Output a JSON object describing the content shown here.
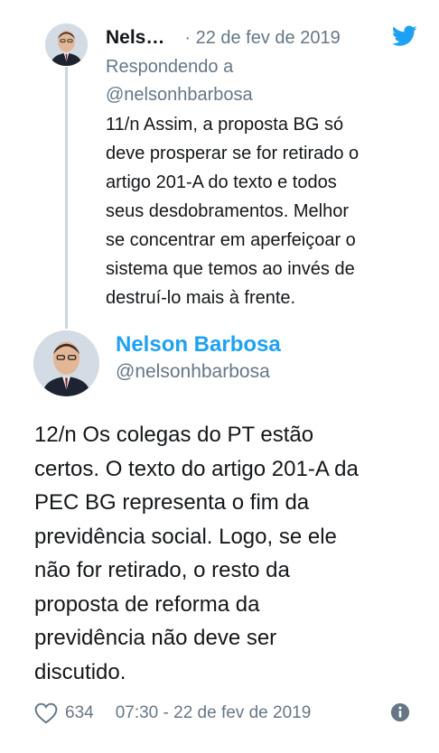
{
  "reply": {
    "author_name": "Nels…",
    "date": "· 22 de fev de 2019",
    "context_line1": "Respondendo a",
    "context_line2": "@nelsonhbarbosa",
    "text": "11/n Assim, a proposta BG só\ndeve prosperar se for retirado o\nartigo 201-A do texto e todos\nseus desdobramentos. Melhor\nse concentrar em aperfeiçoar o\nsistema que temos ao invés de\ndestruí-lo mais à frente."
  },
  "main": {
    "author_name": "Nelson Barbosa",
    "handle": "@nelsonhbarbosa",
    "text": "12/n Os colegas do PT estão\ncertos. O texto do artigo 201-A da\nPEC BG representa o fim da\nprevidência social. Logo, se ele\nnão for retirado, o resto da\nproposta de reforma da\nprevidência não deve ser\ndiscutido.",
    "likes": "634",
    "timestamp": "07:30 - 22 de fev de 2019"
  },
  "colors": {
    "accent": "#1da1f2",
    "muted": "#657786",
    "text": "#14171a",
    "thread": "#ccd6dd"
  },
  "icons": {
    "bird": "twitter-bird-icon",
    "heart": "heart-icon",
    "info": "info-icon"
  }
}
